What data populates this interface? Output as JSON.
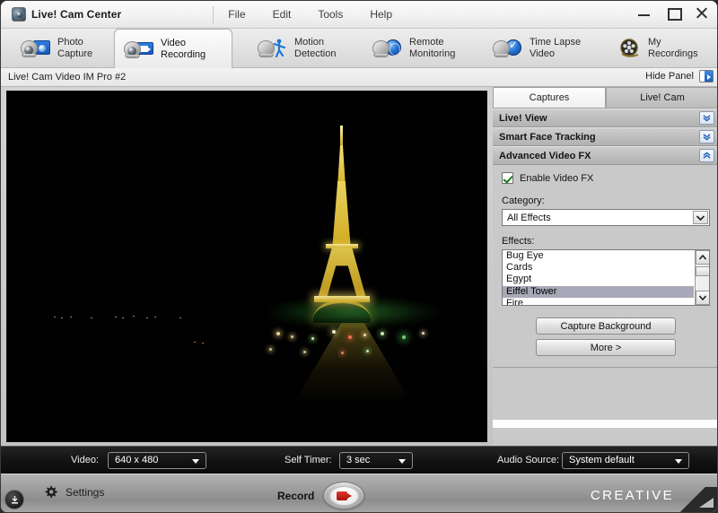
{
  "window": {
    "title": "Live! Cam Center",
    "app_icon": "webcam-icon",
    "controls": {
      "minimize": "minimize-icon",
      "maximize": "maximize-icon",
      "close": "close-icon"
    }
  },
  "menubar": {
    "items": [
      {
        "label": "File"
      },
      {
        "label": "Edit"
      },
      {
        "label": "Tools"
      },
      {
        "label": "Help"
      }
    ]
  },
  "tabs": [
    {
      "label": "Photo\nCapture",
      "icon": "webcam-photo-icon",
      "active": false
    },
    {
      "label": "Video\nRecording",
      "icon": "webcam-video-icon",
      "active": true
    },
    {
      "label": "Motion\nDetection",
      "icon": "motion-detect-icon",
      "active": false
    },
    {
      "label": "Remote\nMonitoring",
      "icon": "remote-globe-icon",
      "active": false
    },
    {
      "label": "Time Lapse\nVideo",
      "icon": "time-lapse-icon",
      "active": false
    },
    {
      "label": "My\nRecordings",
      "icon": "film-reel-icon",
      "active": false
    }
  ],
  "devicebar": {
    "device_name": "Live! Cam Video IM Pro #2",
    "hide_panel_label": "Hide Panel",
    "hide_panel_icon": "panel-collapse-icon"
  },
  "preview": {
    "alt": "Eiffel Tower illuminated at night over dark water"
  },
  "panel": {
    "tabs": [
      {
        "label": "Captures",
        "active": false
      },
      {
        "label": "Live! Cam",
        "active": true
      }
    ],
    "sections": [
      {
        "title": "Live! View",
        "expanded": false,
        "toggle_icon": "chevron-double-down-icon"
      },
      {
        "title": "Smart Face Tracking",
        "expanded": false,
        "toggle_icon": "chevron-double-down-icon"
      },
      {
        "title": "Advanced Video FX",
        "expanded": true,
        "toggle_icon": "chevron-double-up-icon"
      }
    ],
    "video_fx": {
      "enable_label": "Enable Video FX",
      "enable_checked": true,
      "category_label": "Category:",
      "category_value": "All Effects",
      "category_options": [
        "All Effects"
      ],
      "effects_label": "Effects:",
      "effects": [
        {
          "label": "Bug Eye",
          "selected": false
        },
        {
          "label": "Cards",
          "selected": false
        },
        {
          "label": "Egypt",
          "selected": false
        },
        {
          "label": "Eiffel Tower",
          "selected": true
        },
        {
          "label": "Fire",
          "selected": false
        }
      ],
      "capture_background_label": "Capture Background",
      "more_label": "More >"
    }
  },
  "settingsbar": {
    "video_label": "Video:",
    "video_value": "640 x 480",
    "video_options": [
      "640 x 480"
    ],
    "self_timer_label": "Self Timer:",
    "self_timer_value": "3 sec",
    "self_timer_options": [
      "3 sec"
    ],
    "audio_source_label": "Audio Source:",
    "audio_source_value": "System default",
    "audio_source_options": [
      "System default"
    ]
  },
  "footer": {
    "corner_icon": "minimize-to-tray-icon",
    "settings_label": "Settings",
    "settings_icon": "gear-icon",
    "record_label": "Record",
    "record_icon": "record-camcorder-icon",
    "brand": "CREATIVE"
  },
  "colors": {
    "accent_blue": "#1757b8",
    "record_red": "#c0201a",
    "selection_gray": "#a8a8b8",
    "panel_bg": "#c9c9c9",
    "dark_bar": "#121212"
  }
}
